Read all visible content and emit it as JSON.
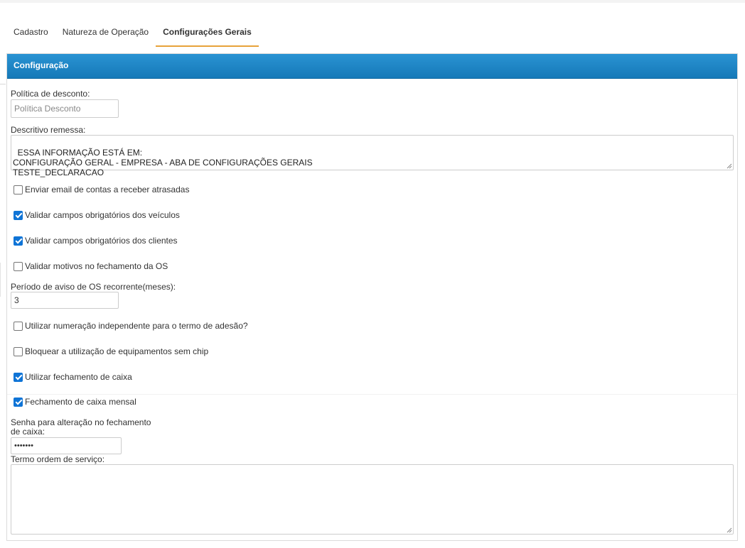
{
  "tabs": [
    {
      "label": "Cadastro",
      "active": false
    },
    {
      "label": "Natureza de Operação",
      "active": false
    },
    {
      "label": "Configurações Gerais",
      "active": true
    }
  ],
  "colors": {
    "header_blue": "#1a86c7",
    "active_tab_underline": "#e8a33a",
    "checkbox_checked": "#0f74d6"
  },
  "panel": {
    "title": "Configuração",
    "politica_desconto": {
      "label": "Política de desconto:",
      "placeholder": "Política Desconto",
      "value": ""
    },
    "descritivo_remessa": {
      "label": "Descritivo remessa:",
      "value": "ESSA INFORMAÇÃO ESTÁ EM:\nCONFIGURAÇÃO GERAL - EMPRESA - ABA DE CONFIGURAÇÕES GERAIS\nTESTE_DECLARACAO"
    },
    "checkboxes": [
      {
        "label": "Enviar email de contas a receber atrasadas",
        "checked": false
      },
      {
        "label": "Validar campos obrigatórios dos veículos",
        "checked": true
      },
      {
        "label": "Validar campos obrigatórios dos clientes",
        "checked": true
      },
      {
        "label": "Validar motivos no fechamento da OS",
        "checked": false
      },
      {
        "label": "Utilizar numeração independente para o termo de adesão?",
        "checked": false
      },
      {
        "label": "Bloquear a utilização de equipamentos sem chip",
        "checked": false
      },
      {
        "label": "Utilizar fechamento de caixa",
        "checked": true
      },
      {
        "label": "Fechamento de caixa mensal",
        "checked": true
      }
    ],
    "periodo_aviso": {
      "label": "Período de aviso de OS recorrente(meses):",
      "value": "3"
    },
    "senha_fechamento": {
      "label_line1": "Senha para alteração no fechamento",
      "label_line2": "de caixa:",
      "value": "1234567"
    },
    "termo_os": {
      "label": "Termo ordem de serviço:",
      "value": ""
    }
  }
}
